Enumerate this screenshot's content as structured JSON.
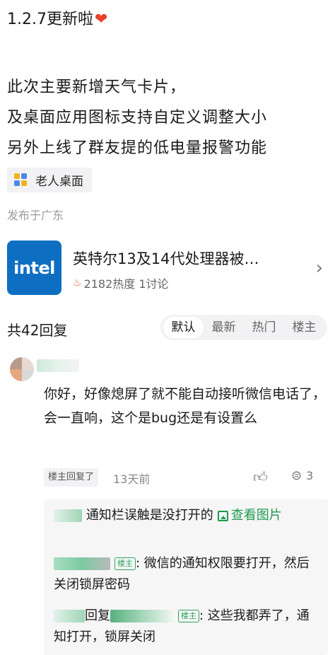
{
  "post": {
    "title": "1.2.7更新啦",
    "body_lines": [
      "此次主要新增天气卡片，",
      "及桌面应用图标支持自定义调整大小",
      "另外上线了群友提的低电量报警功能"
    ],
    "tag": "老人桌面",
    "location": "发布于广东"
  },
  "topic": {
    "logo_text": "intel",
    "title": "英特尔13及14代处理器被…",
    "meta": "2182热度 1讨论"
  },
  "replies": {
    "count_label": "共42回复",
    "sort_tabs": [
      "默认",
      "最新",
      "热门",
      "楼主"
    ],
    "active_tab": "默认"
  },
  "comment": {
    "text": "你好，好像熄屏了就不能自动接听微信电话了，会一直响，这个是bug还是有设置么",
    "op_replied": "楼主回复了",
    "time": "13天前",
    "reply_count": "3",
    "sub_replies": [
      {
        "text": "通知栏误触是没打开的",
        "link": "查看图片"
      },
      {
        "badge": "楼主",
        "text": ": 微信的通知权限要打开，然后关闭锁屏密码"
      },
      {
        "reply_word": "回复",
        "badge": "楼主",
        "text": ": 这些我都弄了，通知打开，锁屏关闭"
      }
    ]
  },
  "colors": {
    "intel_blue": "#0e6fc2",
    "heart": "#e8412d",
    "owner_green": "#2fa35b"
  }
}
